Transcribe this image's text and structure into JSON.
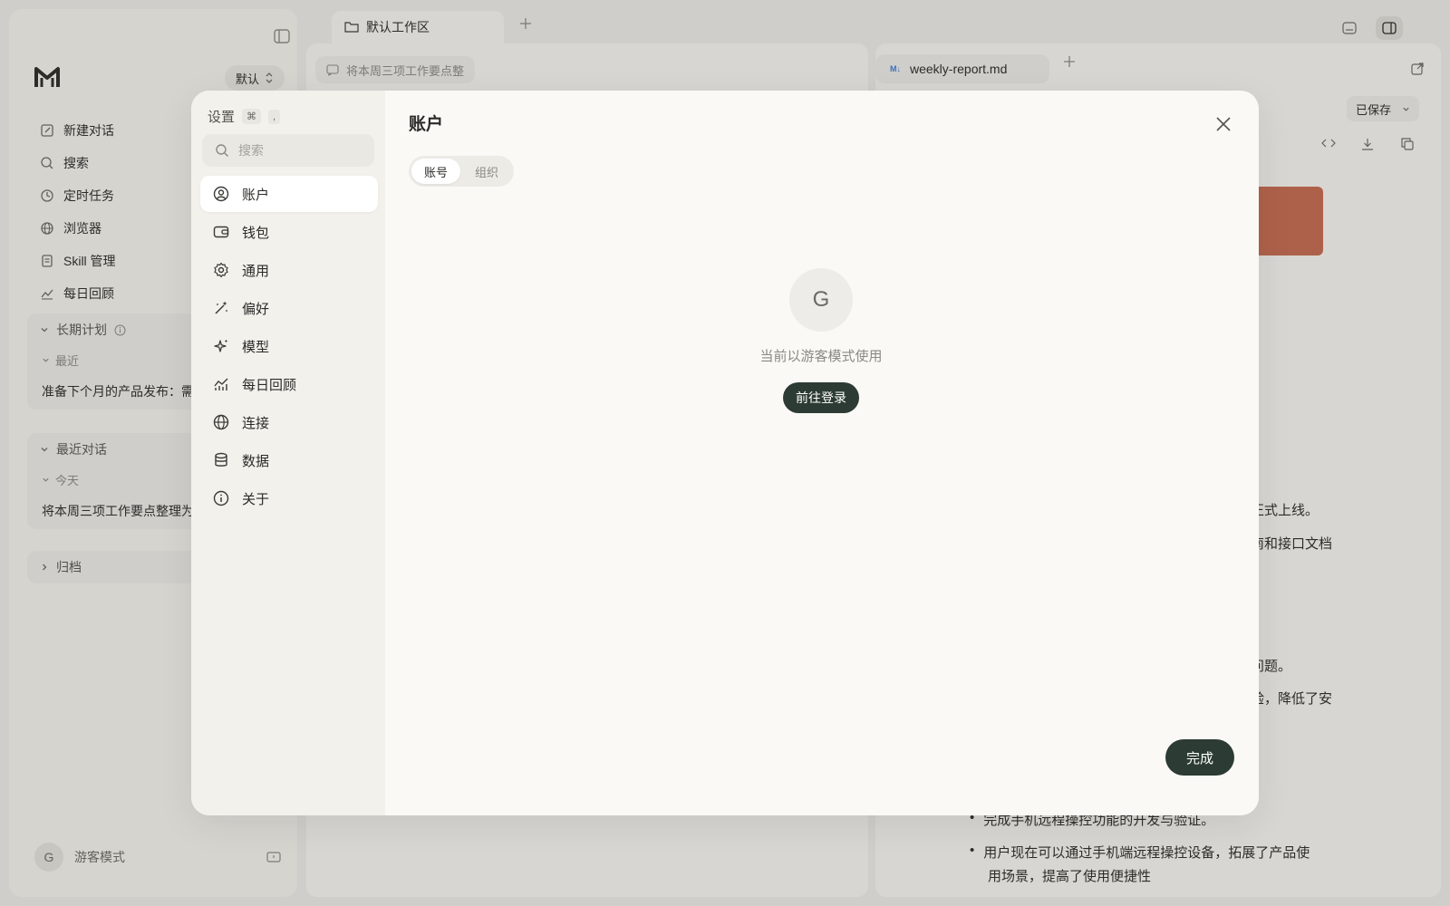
{
  "sidebar": {
    "workspace_selector": "默认",
    "nav": [
      {
        "label": "新建对话",
        "icon": "edit-icon"
      },
      {
        "label": "搜索",
        "icon": "search-icon"
      },
      {
        "label": "定时任务",
        "icon": "clock-icon"
      },
      {
        "label": "浏览器",
        "icon": "globe-icon"
      },
      {
        "label": "Skill 管理",
        "icon": "skill-icon"
      },
      {
        "label": "每日回顾",
        "icon": "chart-icon"
      }
    ],
    "long_term": {
      "title": "长期计划",
      "sub": "最近",
      "item": "准备下个月的产品发布：需要"
    },
    "recent": {
      "title": "最近对话",
      "sub": "今天",
      "item": "将本周三项工作要点整理为结构"
    },
    "archive": {
      "title": "归档"
    },
    "guest": {
      "avatar": "G",
      "label": "游客模式"
    }
  },
  "main": {
    "workspace_tab": "默认工作区",
    "chat_chip": "将本周三项工作要点整",
    "file_tab": {
      "badge": "M↓",
      "name": "weekly-report.md"
    },
    "saved_label": "已保存",
    "doc_lines": [
      "正式上线。",
      "南和接口文档",
      "问题。",
      "验，降低了安"
    ],
    "bullets": [
      "完成手机远程操控功能的开发与验证。",
      "用户现在可以通过手机端远程操控设备，拓展了产品使",
      "用场景，提高了使用便捷性"
    ]
  },
  "modal": {
    "title": "设置",
    "shortcut": [
      "⌘",
      ","
    ],
    "search_placeholder": "搜索",
    "nav": [
      {
        "label": "账户",
        "icon": "user-circle-icon",
        "active": true
      },
      {
        "label": "钱包",
        "icon": "wallet-icon"
      },
      {
        "label": "通用",
        "icon": "gear-icon"
      },
      {
        "label": "偏好",
        "icon": "magic-wand-icon"
      },
      {
        "label": "模型",
        "icon": "sparkle-icon"
      },
      {
        "label": "每日回顾",
        "icon": "chart-icon"
      },
      {
        "label": "连接",
        "icon": "globe-icon"
      },
      {
        "label": "数据",
        "icon": "database-icon"
      },
      {
        "label": "关于",
        "icon": "info-icon"
      }
    ],
    "section_title": "账户",
    "tabs": [
      {
        "label": "账号",
        "active": true
      },
      {
        "label": "组织"
      }
    ],
    "avatar": "G",
    "guest_message": "当前以游客模式使用",
    "login_button": "前往登录",
    "done_button": "完成"
  },
  "colors": {
    "accent": "#2c3b34",
    "banner": "#c4694f",
    "modal_bg": "#faf9f5"
  }
}
